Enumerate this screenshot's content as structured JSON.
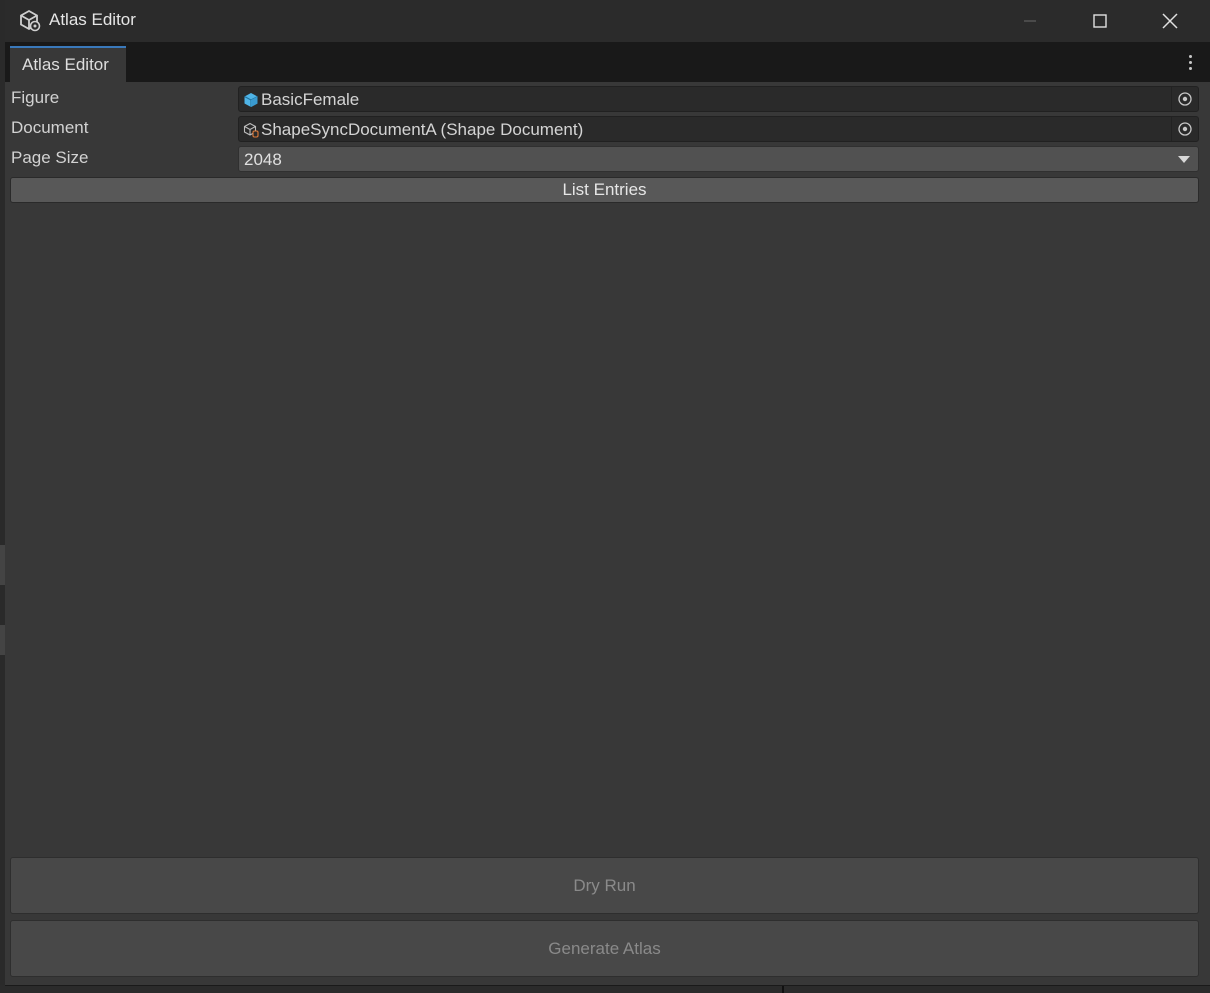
{
  "window": {
    "title": "Atlas Editor",
    "icon": "unity-cube-icon"
  },
  "tabs": [
    {
      "label": "Atlas Editor",
      "active": true
    }
  ],
  "fields": {
    "figure": {
      "label": "Figure",
      "value": "BasicFemale",
      "icon": "prefab-cube-icon"
    },
    "document": {
      "label": "Document",
      "value": "ShapeSyncDocumentA (Shape Document)",
      "icon": "scriptable-object-icon"
    },
    "page_size": {
      "label": "Page Size",
      "value": "2048"
    }
  },
  "buttons": {
    "list_entries": "List Entries",
    "dry_run": "Dry Run",
    "generate_atlas": "Generate Atlas"
  },
  "colors": {
    "accent": "#3a79bb",
    "prefab_icon": "#4fb4e6",
    "panel": "#383838"
  }
}
